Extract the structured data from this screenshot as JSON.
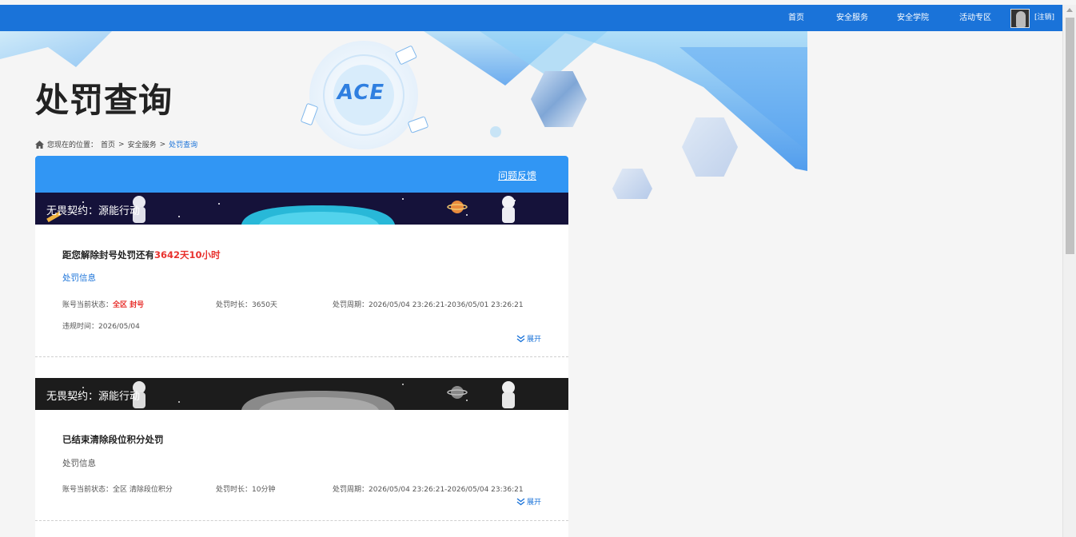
{
  "nav": {
    "items": [
      "首页",
      "安全服务",
      "安全学院",
      "活动专区"
    ],
    "logout": "[注销]"
  },
  "page": {
    "title": "处罚查询"
  },
  "breadcrumb": {
    "prefix": "您现在的位置：",
    "items": [
      "首页",
      "安全服务",
      "处罚查询"
    ],
    "separator": ">"
  },
  "panel": {
    "feedback_label": "问题反馈"
  },
  "records": [
    {
      "game_title": "无畏契约：源能行动",
      "headline_prefix": "距您解除封号处罚还有",
      "headline_highlight": "3642天10小时",
      "section_label": "处罚信息",
      "status_label": "账号当前状态：",
      "status_value": "全区 封号",
      "duration_label": "处罚时长：",
      "duration_value": "3650天",
      "period_label": "处罚周期：",
      "period_value": "2026/05/04 23:26:21-2036/05/01 23:26:21",
      "violation_label": "违规时间：",
      "violation_value": "2026/05/04",
      "expand_label": "展开"
    },
    {
      "game_title": "无畏契约：源能行动",
      "headline": "已结束清除段位积分处罚",
      "section_label": "处罚信息",
      "status_label": "账号当前状态：",
      "status_value": "全区 清除段位积分",
      "duration_label": "处罚时长：",
      "duration_value": "10分钟",
      "period_label": "处罚周期：",
      "period_value": "2026/05/04 23:26:21-2026/05/04 23:36:21",
      "expand_label": "展开"
    }
  ],
  "banner": {
    "logo_text": "ACE"
  },
  "colors": {
    "nav_bg": "#1a73d9",
    "panel_head": "#3196f4",
    "alert": "#e8322e",
    "link": "#1a73d9"
  }
}
